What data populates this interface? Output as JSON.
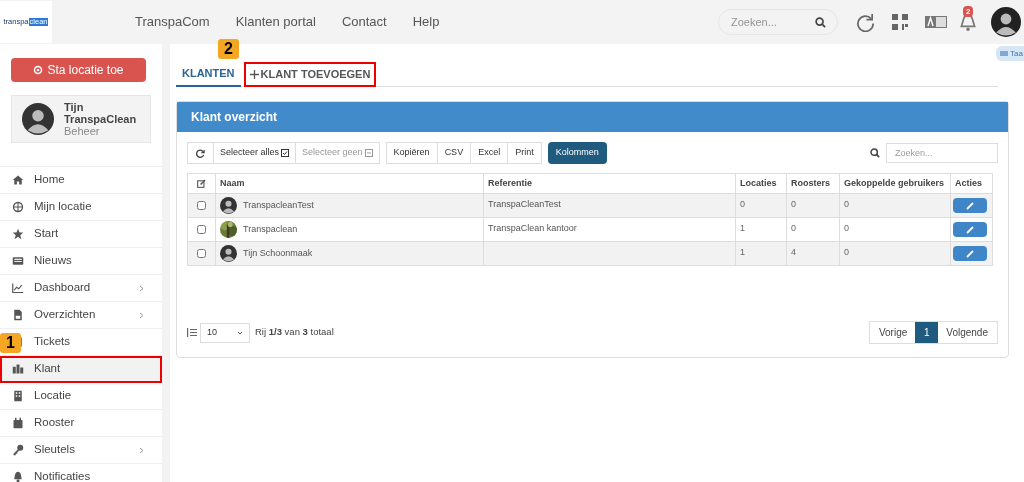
{
  "logo": {
    "parts": [
      "transpa",
      "clean"
    ]
  },
  "top_nav": [
    "TranspaCom",
    "Klanten portal",
    "Contact",
    "Help"
  ],
  "header_search": {
    "placeholder": "Zoeken..."
  },
  "notifications": {
    "count": "2"
  },
  "side_tab": {
    "label": "Taa"
  },
  "sidebar": {
    "action_button": "Sta locatie toe",
    "user": {
      "name": "Tijn TranspaClean",
      "role": "Beheer"
    },
    "items": [
      {
        "label": "Home",
        "kind": "home",
        "has_submenu": false,
        "selected": false
      },
      {
        "label": "Mijn locatie",
        "kind": "globe",
        "has_submenu": false,
        "selected": false
      },
      {
        "label": "Start",
        "kind": "star",
        "has_submenu": false,
        "selected": false
      },
      {
        "label": "Nieuws",
        "kind": "news",
        "has_submenu": false,
        "selected": false
      },
      {
        "label": "Dashboard",
        "kind": "chart",
        "has_submenu": true,
        "selected": false
      },
      {
        "label": "Overzichten",
        "kind": "file",
        "has_submenu": true,
        "selected": false
      },
      {
        "label": "Tickets",
        "kind": "ticket",
        "has_submenu": false,
        "selected": false
      },
      {
        "label": "Klant",
        "kind": "buildings",
        "has_submenu": false,
        "selected": true
      },
      {
        "label": "Locatie",
        "kind": "building",
        "has_submenu": false,
        "selected": false
      },
      {
        "label": "Rooster",
        "kind": "calendar",
        "has_submenu": false,
        "selected": false
      },
      {
        "label": "Sleutels",
        "kind": "key",
        "has_submenu": true,
        "selected": false
      },
      {
        "label": "Notificaties",
        "kind": "bell",
        "has_submenu": false,
        "selected": false
      }
    ]
  },
  "tabs": [
    {
      "label": "KLANTEN",
      "kind": "plain",
      "selected": true
    },
    {
      "label": "KLANT TOEVOEGEN",
      "kind": "add",
      "selected": false
    }
  ],
  "step_badges": [
    "1",
    "2"
  ],
  "panel": {
    "title": "Klant overzicht",
    "toolbar": [
      {
        "label": "Selecteer alles",
        "kind": "select_all",
        "disabled": false
      },
      {
        "label": "Selecteer geen",
        "kind": "select_none",
        "disabled": true
      }
    ],
    "export_buttons": [
      "Kopiëren",
      "CSV",
      "Excel",
      "Print"
    ],
    "columns_button": "Kolommen",
    "search": {
      "placeholder": "Zoeken..."
    },
    "table": {
      "columns": [
        "Naam",
        "Referentie",
        "Locaties",
        "Roosters",
        "Gekoppelde gebruikers",
        "Acties"
      ],
      "rows": [
        {
          "checked": false,
          "kind": "silhouette",
          "naam": "TranspacleanTest",
          "referentie": "TranspaCleanTest",
          "locaties": "0",
          "roosters": "0",
          "gekoppelde_gebruikers": "0"
        },
        {
          "checked": false,
          "kind": "picture",
          "naam": "Transpaclean",
          "referentie": "TranspaClean kantoor",
          "locaties": "1",
          "roosters": "0",
          "gekoppelde_gebruikers": "0"
        },
        {
          "checked": false,
          "kind": "silhouette",
          "naam": "Tijn Schoonmaak",
          "referentie": "",
          "locaties": "1",
          "roosters": "4",
          "gekoppelde_gebruikers": "0"
        }
      ]
    },
    "page_size": "10",
    "summary": "Rij **1/3** van **3** totaal",
    "pagination": [
      {
        "label": "Vorige",
        "kind": "prev",
        "selected": false
      },
      {
        "label": "1",
        "kind": "page",
        "selected": true
      },
      {
        "label": "Volgende",
        "kind": "next",
        "selected": false
      }
    ]
  }
}
